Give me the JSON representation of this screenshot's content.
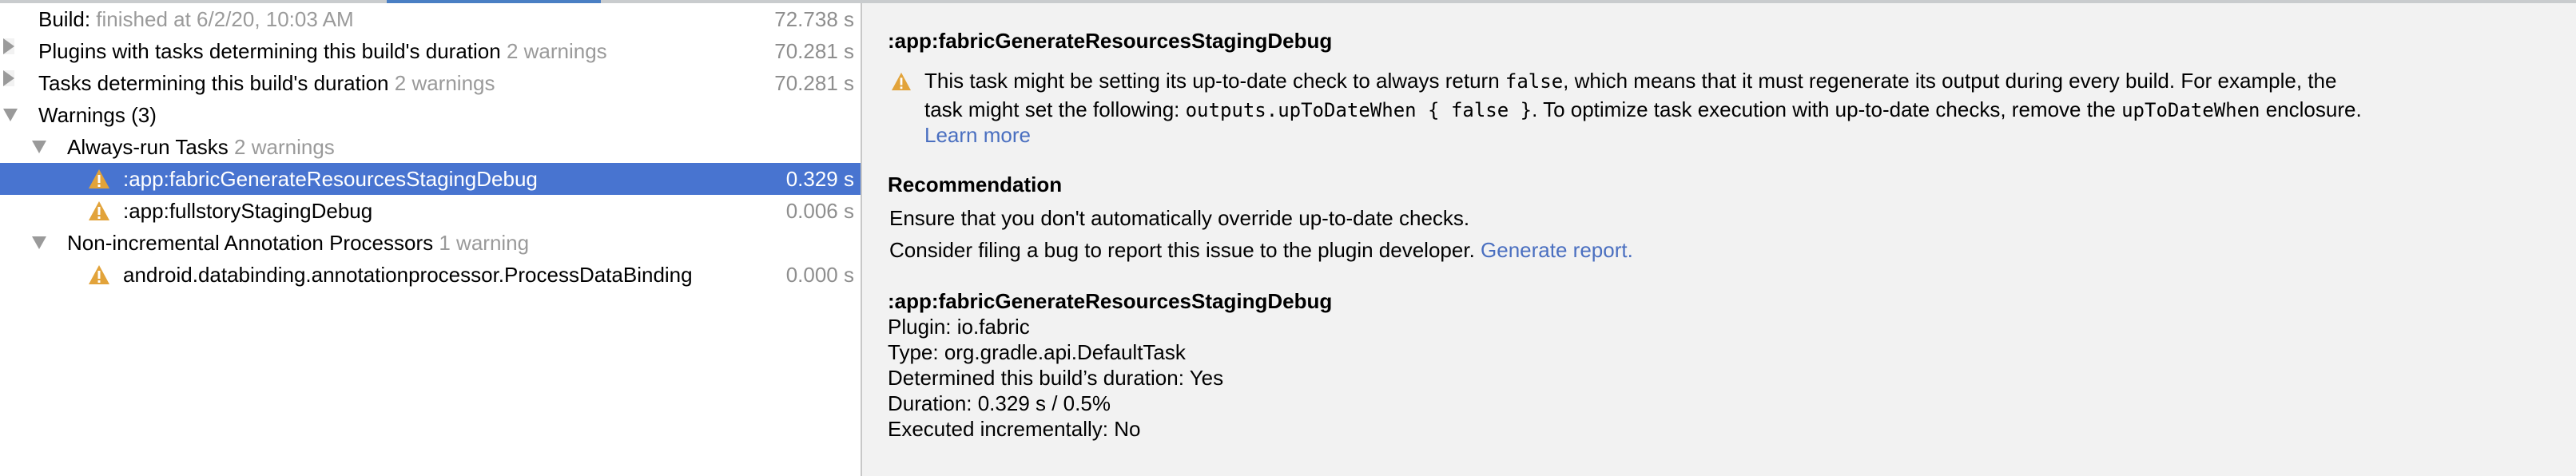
{
  "tree": {
    "build": {
      "label": "Build:",
      "status": "finished at 6/2/20, 10:03 AM",
      "duration": "72.738 s"
    },
    "plugins": {
      "label": "Plugins with tasks determining this build's duration",
      "badge": "2 warnings",
      "duration": "70.281 s"
    },
    "tasks": {
      "label": "Tasks determining this build's duration",
      "badge": "2 warnings",
      "duration": "70.281 s"
    },
    "warnings": {
      "label": "Warnings (3)"
    },
    "always_run": {
      "label": "Always-run Tasks",
      "badge": "2 warnings"
    },
    "always_run_items": [
      {
        "label": ":app:fabricGenerateResourcesStagingDebug",
        "duration": "0.329 s",
        "selected": true
      },
      {
        "label": ":app:fullstoryStagingDebug",
        "duration": "0.006 s",
        "selected": false
      }
    ],
    "non_incremental": {
      "label": "Non-incremental Annotation Processors",
      "badge": "1 warning"
    },
    "non_incremental_items": [
      {
        "label": "android.databinding.annotationprocessor.ProcessDataBinding",
        "duration": "0.000 s"
      }
    ]
  },
  "detail": {
    "title": ":app:fabricGenerateResourcesStagingDebug",
    "warning": {
      "line1_a": "This task might be setting its up-to-date check to always return ",
      "line1_code": "false",
      "line1_b": ", which means that it must regenerate its output during every build. For example, the",
      "line2_a": "task might set the following: ",
      "line2_code": "outputs.upToDateWhen { false }",
      "line2_b": ". To optimize task execution with up-to-date checks, remove the ",
      "line2_code2": "upToDateWhen",
      "line2_c": " enclosure.",
      "learn_more": "Learn more"
    },
    "recommendation": {
      "heading": "Recommendation",
      "line1": "Ensure that you don't automatically override up-to-date checks.",
      "line2": "Consider filing a bug to report this issue to the plugin developer.",
      "generate_report": "Generate report."
    },
    "info": {
      "title": ":app:fabricGenerateResourcesStagingDebug",
      "plugin": "Plugin: io.fabric",
      "type": "Type: org.gradle.api.DefaultTask",
      "determined": "Determined this build’s duration: Yes",
      "duration": "Duration: 0.329 s / 0.5%",
      "incremental": "Executed incrementally: No"
    }
  },
  "colors": {
    "selection": "#4874d0",
    "link": "#4a6fc0",
    "warning": "#e2a33a",
    "accent": "#4a7fc4"
  }
}
